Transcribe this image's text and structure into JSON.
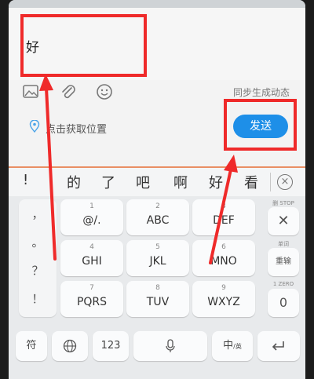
{
  "composer": {
    "input_text": "好",
    "sync_label": "同步生成动态",
    "location_label": "点击获取位置",
    "send_label": "发送"
  },
  "toolbar_icons": [
    "image-icon",
    "attachment-icon",
    "emoji-icon"
  ],
  "keyboard": {
    "candidates": [
      "!",
      "的",
      "了",
      "吧",
      "啊",
      "好",
      "看"
    ],
    "symbols": [
      "，",
      "。",
      "？",
      "！"
    ],
    "keys": [
      {
        "num": "1",
        "label": "@/."
      },
      {
        "num": "2",
        "label": "ABC"
      },
      {
        "num": "3",
        "label": "DEF"
      },
      {
        "num": "4",
        "label": "GHI"
      },
      {
        "num": "5",
        "label": "JKL"
      },
      {
        "num": "6",
        "label": "MNO"
      },
      {
        "num": "7",
        "label": "PQRS"
      },
      {
        "num": "8",
        "label": "TUV"
      },
      {
        "num": "9",
        "label": "WXYZ"
      }
    ],
    "side": {
      "delete_caption": "删 STOP",
      "retype_caption": "单词",
      "retype_label": "重输",
      "zero_caption": "1 ZERO",
      "zero_label": "0"
    },
    "bottom": {
      "symbol_label": "符",
      "num_label": "123",
      "lang_label": "中",
      "lang_sub": "/英"
    }
  },
  "colors": {
    "send_button": "#1e8fe8",
    "annotation_red": "#ef2a2a",
    "divider_orange": "#e98f64"
  }
}
